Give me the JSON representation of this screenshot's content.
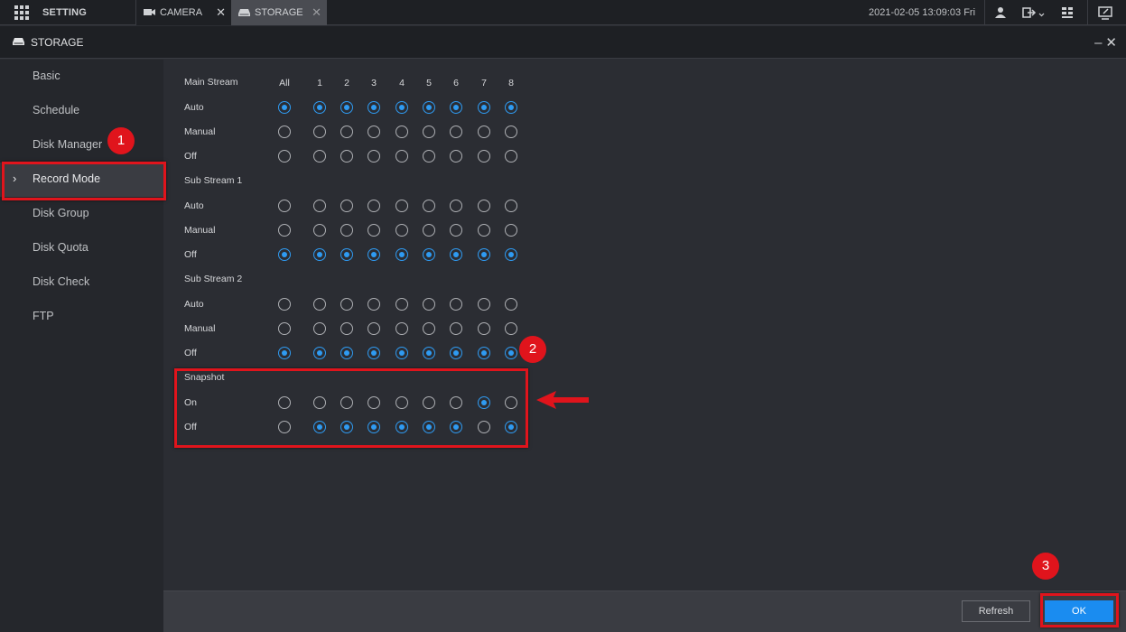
{
  "topbar": {
    "setting_label": "SETTING",
    "tabs": [
      {
        "label": "CAMERA",
        "close": "✕"
      },
      {
        "label": "STORAGE",
        "close": "✕"
      }
    ],
    "datetime": "2021-02-05 13:09:03 Fri"
  },
  "titlebar": {
    "title": "STORAGE",
    "minimize": "–",
    "close": "✕"
  },
  "sidebar": {
    "items": [
      {
        "label": "Basic"
      },
      {
        "label": "Schedule"
      },
      {
        "label": "Disk Manager"
      },
      {
        "label": "Record Mode",
        "active": true
      },
      {
        "label": "Disk Group"
      },
      {
        "label": "Disk Quota"
      },
      {
        "label": "Disk Check"
      },
      {
        "label": "FTP"
      }
    ],
    "active_marker": "›"
  },
  "record_mode": {
    "columns": [
      "All",
      "1",
      "2",
      "3",
      "4",
      "5",
      "6",
      "7",
      "8"
    ],
    "sections": [
      {
        "title": "Main Stream",
        "rows": [
          {
            "label": "Auto",
            "checked": [
              1,
              1,
              1,
              1,
              1,
              1,
              1,
              1,
              1
            ]
          },
          {
            "label": "Manual",
            "checked": [
              0,
              0,
              0,
              0,
              0,
              0,
              0,
              0,
              0
            ]
          },
          {
            "label": "Off",
            "checked": [
              0,
              0,
              0,
              0,
              0,
              0,
              0,
              0,
              0
            ]
          }
        ]
      },
      {
        "title": "Sub Stream 1",
        "rows": [
          {
            "label": "Auto",
            "checked": [
              0,
              0,
              0,
              0,
              0,
              0,
              0,
              0,
              0
            ]
          },
          {
            "label": "Manual",
            "checked": [
              0,
              0,
              0,
              0,
              0,
              0,
              0,
              0,
              0
            ]
          },
          {
            "label": "Off",
            "checked": [
              1,
              1,
              1,
              1,
              1,
              1,
              1,
              1,
              1
            ]
          }
        ]
      },
      {
        "title": "Sub Stream 2",
        "rows": [
          {
            "label": "Auto",
            "checked": [
              0,
              0,
              0,
              0,
              0,
              0,
              0,
              0,
              0
            ]
          },
          {
            "label": "Manual",
            "checked": [
              0,
              0,
              0,
              0,
              0,
              0,
              0,
              0,
              0
            ]
          },
          {
            "label": "Off",
            "checked": [
              1,
              1,
              1,
              1,
              1,
              1,
              1,
              1,
              1
            ]
          }
        ]
      },
      {
        "title": "Snapshot",
        "rows": [
          {
            "label": "On",
            "checked": [
              0,
              0,
              0,
              0,
              0,
              0,
              0,
              1,
              0
            ]
          },
          {
            "label": "Off",
            "checked": [
              0,
              1,
              1,
              1,
              1,
              1,
              1,
              0,
              1
            ]
          }
        ]
      }
    ]
  },
  "footer": {
    "refresh_label": "Refresh",
    "ok_label": "OK"
  },
  "annotations": {
    "badges": [
      "1",
      "2",
      "3"
    ]
  },
  "colors": {
    "accent": "#2f9bf2",
    "ok_button": "#1a8cf0",
    "annotation_red": "#e0141c",
    "background": "#2b2d33",
    "sidebar": "#25272c"
  }
}
